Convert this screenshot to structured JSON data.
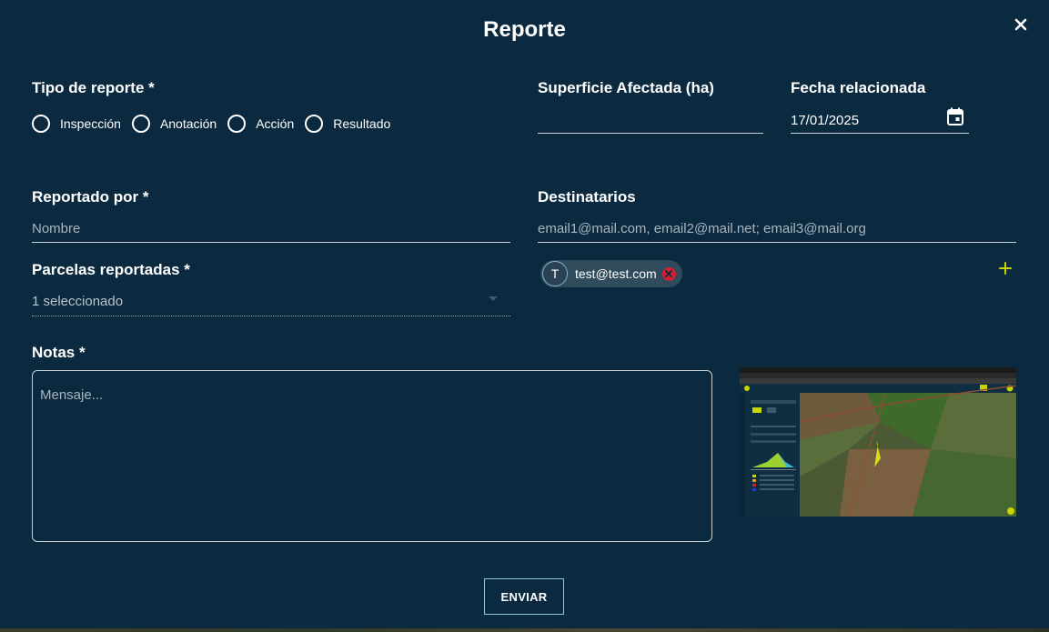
{
  "dialog": {
    "title": "Reporte"
  },
  "report_type": {
    "label": "Tipo de reporte *",
    "options": [
      "Inspección",
      "Anotación",
      "Acción",
      "Resultado"
    ]
  },
  "area": {
    "label": "Superficie Afectada (ha)",
    "value": ""
  },
  "date": {
    "label": "Fecha relacionada",
    "value": "17/01/2025"
  },
  "reported_by": {
    "label": "Reportado por *",
    "placeholder": "Nombre"
  },
  "recipients": {
    "label": "Destinatarios",
    "placeholder": "email1@mail.com, email2@mail.net; email3@mail.org",
    "chips": [
      {
        "initial": "T",
        "email": "test@test.com"
      }
    ]
  },
  "parcels": {
    "label": "Parcelas reportadas *",
    "selected": "1 seleccionado"
  },
  "notes": {
    "label": "Notas *",
    "placeholder": "Mensaje..."
  },
  "submit": {
    "label": "ENVIAR"
  },
  "icons": {
    "close": "close-icon",
    "calendar": "calendar-icon",
    "add": "plus-icon",
    "chip_remove": "remove-icon"
  },
  "colors": {
    "background": "#0b2a40",
    "accent": "#c9d400",
    "chip": "#2f4b5c",
    "remove": "#d02030"
  }
}
